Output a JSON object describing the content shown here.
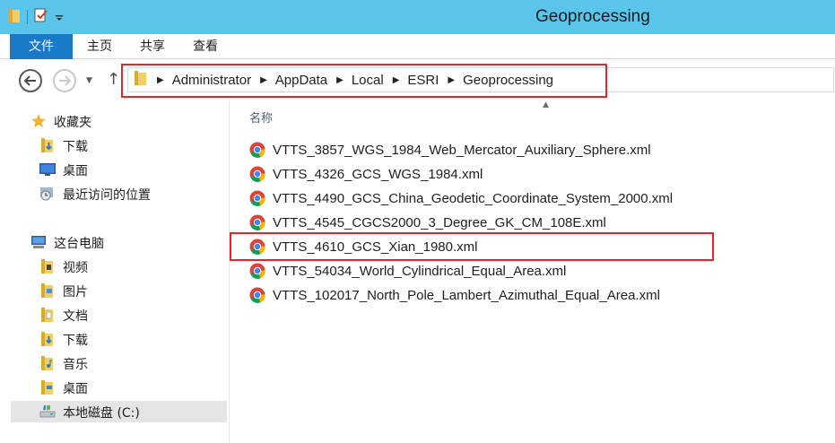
{
  "window": {
    "title": "Geoprocessing",
    "titlebar_color": "#59c5ea"
  },
  "quick_access": {
    "icons": [
      "folder-icon",
      "properties-icon",
      "dropdown-icon"
    ]
  },
  "ribbon": {
    "tabs": [
      {
        "label": "文件",
        "active": true
      },
      {
        "label": "主页"
      },
      {
        "label": "共享"
      },
      {
        "label": "查看"
      }
    ],
    "file_tab_color": "#1979ca"
  },
  "address_bar": {
    "breadcrumbs": [
      "Administrator",
      "AppData",
      "Local",
      "ESRI",
      "Geoprocessing"
    ]
  },
  "sidebar": {
    "favorites": {
      "label": "收藏夹",
      "items": [
        {
          "label": "下载",
          "icon": "download-folder-icon"
        },
        {
          "label": "桌面",
          "icon": "desktop-icon"
        },
        {
          "label": "最近访问的位置",
          "icon": "recent-places-icon"
        }
      ]
    },
    "this_pc": {
      "label": "这台电脑",
      "items": [
        {
          "label": "视频",
          "icon": "videos-folder-icon"
        },
        {
          "label": "图片",
          "icon": "pictures-folder-icon"
        },
        {
          "label": "文档",
          "icon": "documents-folder-icon"
        },
        {
          "label": "下载",
          "icon": "download-folder-icon"
        },
        {
          "label": "音乐",
          "icon": "music-folder-icon"
        },
        {
          "label": "桌面",
          "icon": "desktop-folder-icon"
        },
        {
          "label": "本地磁盘 (C:)",
          "icon": "local-disk-icon",
          "selected": true
        }
      ]
    }
  },
  "file_list": {
    "column_header": "名称",
    "files": [
      "VTTS_3857_WGS_1984_Web_Mercator_Auxiliary_Sphere.xml",
      "VTTS_4326_GCS_WGS_1984.xml",
      "VTTS_4490_GCS_China_Geodetic_Coordinate_System_2000.xml",
      "VTTS_4545_CGCS2000_3_Degree_GK_CM_108E.xml",
      "VTTS_4610_GCS_Xian_1980.xml",
      "VTTS_54034_World_Cylindrical_Equal_Area.xml",
      "VTTS_102017_North_Pole_Lambert_Azimuthal_Equal_Area.xml"
    ],
    "highlighted_index": 4,
    "highlight_color": "#e0282a"
  }
}
